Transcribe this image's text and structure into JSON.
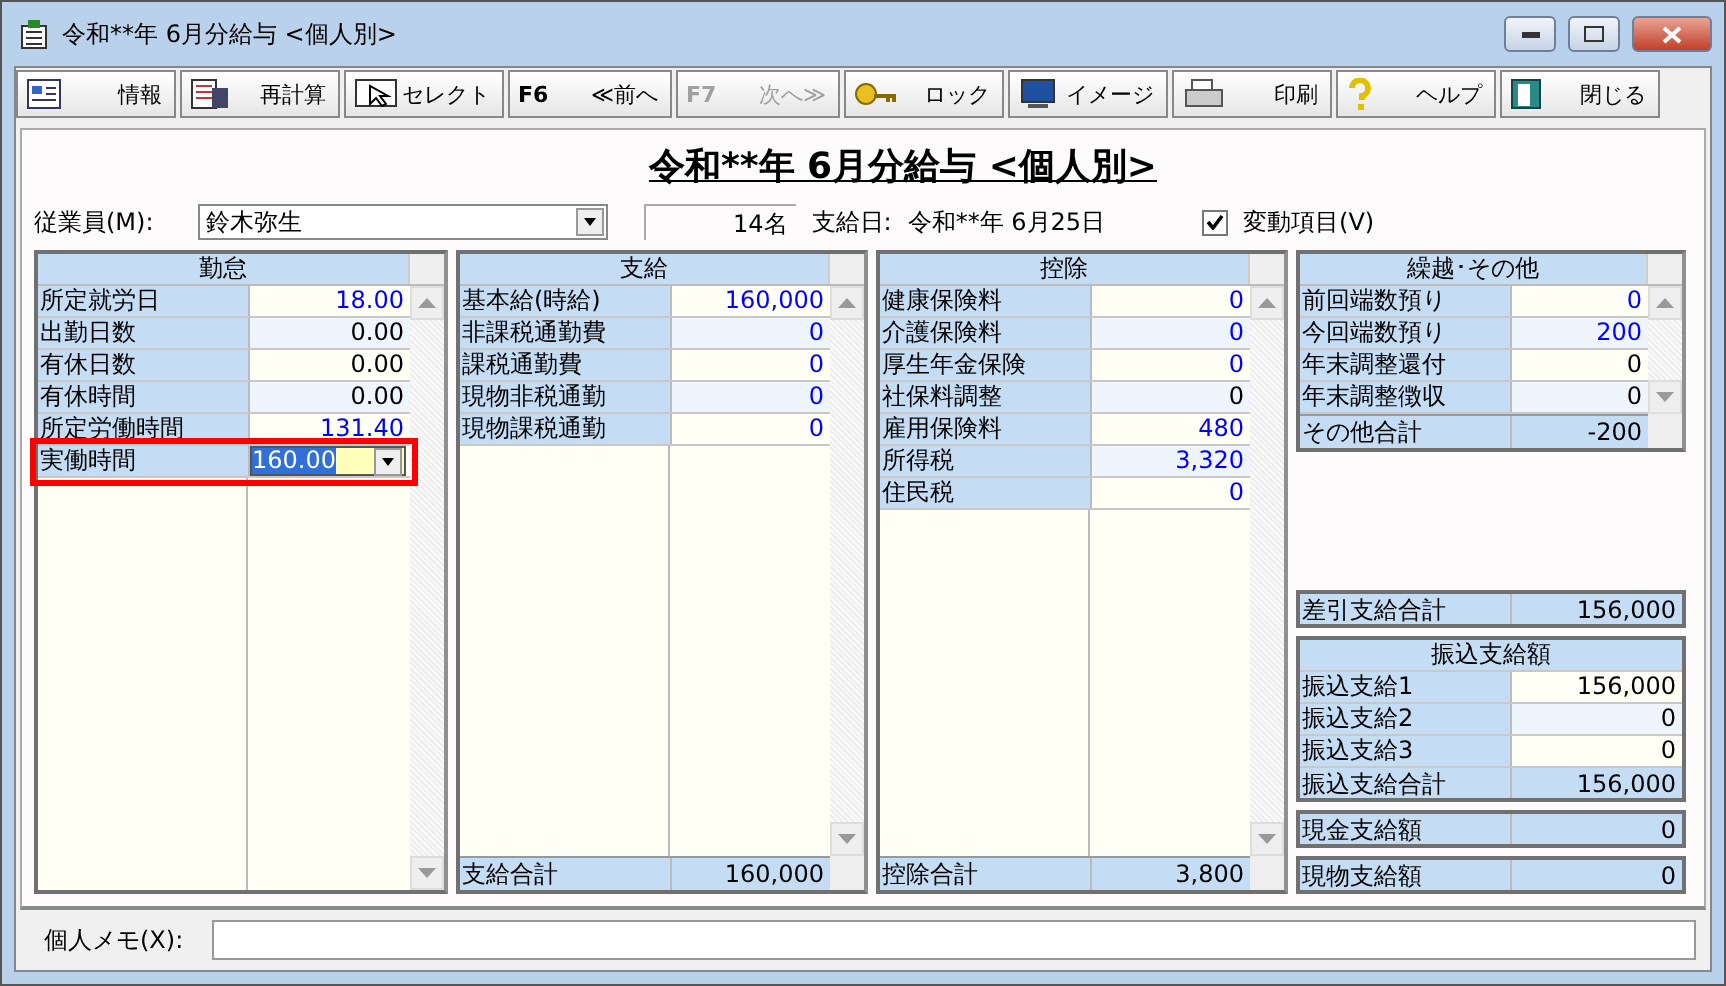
{
  "window": {
    "title": "令和**年 6月分給与 <個人別>"
  },
  "toolbar": [
    {
      "label": "情報",
      "disabled": false
    },
    {
      "label": "再計算",
      "disabled": false
    },
    {
      "label": "セレクト",
      "disabled": false
    },
    {
      "key": "F6",
      "label": "≪前へ",
      "disabled": false
    },
    {
      "key": "F7",
      "label": "次へ≫",
      "disabled": true
    },
    {
      "label": "ロック",
      "disabled": false
    },
    {
      "label": "イメージ",
      "disabled": false
    },
    {
      "label": "印刷",
      "disabled": false
    },
    {
      "label": "ヘルプ",
      "disabled": false
    },
    {
      "label": "閉じる",
      "disabled": false
    }
  ],
  "heading": "令和**年 6月分給与 <個人別>",
  "employee": {
    "label": "従業員(M):",
    "value": "鈴木弥生",
    "count": "14名",
    "pay_date_label": "支給日:",
    "pay_date": "令和**年 6月25日",
    "variable_items": {
      "label": "変動項目(V)",
      "checked": true
    }
  },
  "panels": [
    {
      "title": "勤怠",
      "rows": [
        {
          "label": "所定就労日",
          "value": "18.00",
          "color": "#0000ff",
          "editing": false
        },
        {
          "label": "出勤日数",
          "value": "0.00",
          "color": "#000000",
          "editing": false
        },
        {
          "label": "有休日数",
          "value": "0.00",
          "color": "#000000",
          "editing": false
        },
        {
          "label": "有休時間",
          "value": "0.00",
          "color": "#000000",
          "editing": false
        },
        {
          "label": "所定労働時間",
          "value": "131.40",
          "color": "#0000ff",
          "editing": false
        },
        {
          "label": "実働時間",
          "value": "160.00",
          "editing": true
        }
      ]
    },
    {
      "title": "支給",
      "rows": [
        {
          "label": "基本給(時給)",
          "value": "160,000",
          "color": "#0000ff",
          "editing": false
        },
        {
          "label": "非課税通勤費",
          "value": "0",
          "color": "#0000ff",
          "editing": false
        },
        {
          "label": "課税通勤費",
          "value": "0",
          "color": "#0000ff",
          "editing": false
        },
        {
          "label": "現物非税通勤",
          "value": "0",
          "color": "#0000ff",
          "editing": false
        },
        {
          "label": "現物課税通勤",
          "value": "0",
          "color": "#0000ff",
          "editing": false
        }
      ],
      "total": {
        "label": "支給合計",
        "value": "160,000"
      }
    },
    {
      "title": "控除",
      "rows": [
        {
          "label": "健康保険料",
          "value": "0",
          "color": "#0000ff",
          "editing": false
        },
        {
          "label": "介護保険料",
          "value": "0",
          "color": "#0000ff",
          "editing": false
        },
        {
          "label": "厚生年金保険",
          "value": "0",
          "color": "#0000ff",
          "editing": false
        },
        {
          "label": "社保料調整",
          "value": "0",
          "color": "#000000",
          "editing": false
        },
        {
          "label": "雇用保険料",
          "value": "480",
          "color": "#0000ff",
          "editing": false
        },
        {
          "label": "所得税",
          "value": "3,320",
          "color": "#0000ff",
          "editing": false
        },
        {
          "label": "住民税",
          "value": "0",
          "color": "#0000ff",
          "editing": false
        }
      ],
      "total": {
        "label": "控除合計",
        "value": "3,800"
      }
    },
    {
      "title": "繰越･その他",
      "rows": [
        {
          "label": "前回端数預り",
          "value": "0",
          "color": "#0000ff",
          "editing": false
        },
        {
          "label": "今回端数預り",
          "value": "200",
          "color": "#0000ff",
          "editing": false
        },
        {
          "label": "年末調整還付",
          "value": "0",
          "color": "#000000",
          "editing": false
        },
        {
          "label": "年末調整徴収",
          "value": "0",
          "color": "#000000",
          "editing": false
        }
      ],
      "total": {
        "label": "その他合計",
        "value": "-200"
      }
    }
  ],
  "net_pay": {
    "label": "差引支給合計",
    "value": "156,000"
  },
  "transfer": {
    "title": "振込支給額",
    "rows": [
      {
        "label": "振込支給1",
        "value": "156,000"
      },
      {
        "label": "振込支給2",
        "value": "0"
      },
      {
        "label": "振込支給3",
        "value": "0"
      }
    ],
    "total": {
      "label": "振込支給合計",
      "value": "156,000"
    }
  },
  "cash_pay": {
    "label": "現金支給額",
    "value": "0"
  },
  "in_kind_pay": {
    "label": "現物支給額",
    "value": "0"
  },
  "memo": {
    "label": "個人メモ(X):"
  }
}
